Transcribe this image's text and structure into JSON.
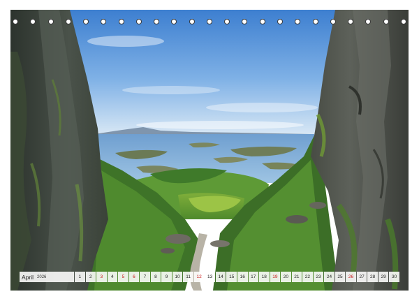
{
  "calendar": {
    "month": "April",
    "year": "2026",
    "days": [
      {
        "label": "1",
        "red": false
      },
      {
        "label": "2",
        "red": false
      },
      {
        "label": "3",
        "red": true
      },
      {
        "label": "4",
        "red": false
      },
      {
        "label": "5",
        "red": true
      },
      {
        "label": "6",
        "red": true
      },
      {
        "label": "7",
        "red": false
      },
      {
        "label": "8",
        "red": false
      },
      {
        "label": "9",
        "red": false
      },
      {
        "label": "10",
        "red": false
      },
      {
        "label": "11",
        "red": false
      },
      {
        "label": "12",
        "red": true
      },
      {
        "label": "13",
        "red": false
      },
      {
        "label": "14",
        "red": false
      },
      {
        "label": "15",
        "red": false
      },
      {
        "label": "16",
        "red": false
      },
      {
        "label": "17",
        "red": false
      },
      {
        "label": "18",
        "red": false
      },
      {
        "label": "19",
        "red": true
      },
      {
        "label": "20",
        "red": false
      },
      {
        "label": "21",
        "red": false
      },
      {
        "label": "22",
        "red": false
      },
      {
        "label": "23",
        "red": false
      },
      {
        "label": "24",
        "red": false
      },
      {
        "label": "25",
        "red": false
      },
      {
        "label": "26",
        "red": true
      },
      {
        "label": "27",
        "red": false
      },
      {
        "label": "28",
        "red": false
      },
      {
        "label": "29",
        "red": false
      },
      {
        "label": "30",
        "red": false
      }
    ],
    "weekend_color": "#c81414",
    "text_color": "#222222"
  },
  "binding": {
    "ring_count": 23
  },
  "photo": {
    "subject": "coastal-valley-landscape"
  }
}
